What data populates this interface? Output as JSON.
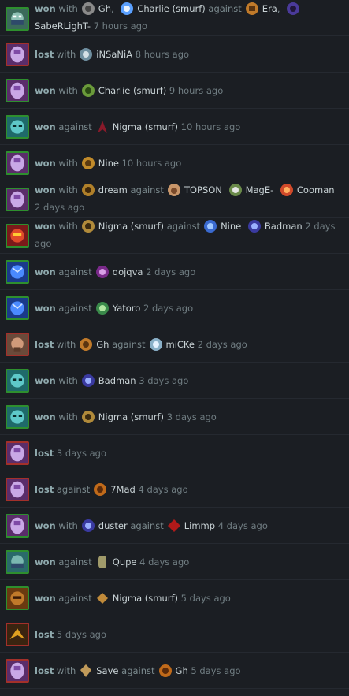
{
  "colors": {
    "won_border": "#2e8f2e",
    "lost_border": "#a3302a",
    "background": "#1d2025"
  },
  "words": {
    "with": "with",
    "against": "against"
  },
  "rows": [
    {
      "result": "won",
      "hero": "tusk-hero",
      "with": [
        "Gh",
        "Charlie (smurf)"
      ],
      "against": [
        "Era",
        "SabeRLighT-"
      ],
      "time": "7 hours ago"
    },
    {
      "result": "lost",
      "hero": "void-spirit-hero",
      "with": [
        "iNSaNiA"
      ],
      "against": [],
      "time": "8 hours ago"
    },
    {
      "result": "won",
      "hero": "void-spirit-hero",
      "with": [
        "Charlie (smurf)"
      ],
      "against": [],
      "time": "9 hours ago"
    },
    {
      "result": "won",
      "hero": "tusk-hero",
      "with": [],
      "against": [
        "Nigma (smurf)"
      ],
      "time": "10 hours ago"
    },
    {
      "result": "won",
      "hero": "void-spirit-hero",
      "with": [
        "Nine"
      ],
      "against": [],
      "time": "10 hours ago"
    },
    {
      "result": "won",
      "hero": "void-spirit-hero",
      "with": [
        "dream"
      ],
      "against": [
        "TOPSON",
        "MagE-",
        "Cooman"
      ],
      "time": "2 days ago"
    },
    {
      "result": "won",
      "hero": "lion-hero",
      "with": [
        "Nigma (smurf)"
      ],
      "against": [
        "Nine",
        "Badman"
      ],
      "time": "2 days ago"
    },
    {
      "result": "won",
      "hero": "storm-hero",
      "with": [],
      "against": [
        "qojqva"
      ],
      "time": "2 days ago"
    },
    {
      "result": "won",
      "hero": "storm-hero",
      "with": [],
      "against": [
        "Yatoro"
      ],
      "time": "2 days ago"
    },
    {
      "result": "lost",
      "hero": "tiny-hero",
      "with": [
        "Gh"
      ],
      "against": [
        "miCKe"
      ],
      "time": "2 days ago"
    },
    {
      "result": "won",
      "hero": "tusk-hero",
      "with": [
        "Badman"
      ],
      "against": [],
      "time": "3 days ago"
    },
    {
      "result": "won",
      "hero": "tusk-hero",
      "with": [
        "Nigma (smurf)"
      ],
      "against": [],
      "time": "3 days ago"
    },
    {
      "result": "lost",
      "hero": "void-spirit-hero",
      "with": [],
      "against": [],
      "time": "3 days ago"
    },
    {
      "result": "lost",
      "hero": "void-spirit-hero",
      "with": [],
      "against": [
        "7Mad"
      ],
      "time": "4 days ago"
    },
    {
      "result": "won",
      "hero": "void-spirit-hero",
      "with": [
        "duster"
      ],
      "against": [
        "Limmp"
      ],
      "time": "4 days ago"
    },
    {
      "result": "won",
      "hero": "tusk-hero",
      "with": [],
      "against": [
        "Qupe"
      ],
      "time": "4 days ago"
    },
    {
      "result": "won",
      "hero": "brewmaster-hero",
      "with": [],
      "against": [
        "Nigma (smurf)"
      ],
      "time": "5 days ago"
    },
    {
      "result": "lost",
      "hero": "phoenix-hero",
      "with": [],
      "against": [],
      "time": "5 days ago"
    },
    {
      "result": "lost",
      "hero": "void-spirit-hero",
      "with": [
        "Save"
      ],
      "against": [
        "Gh"
      ],
      "time": "5 days ago"
    }
  ]
}
